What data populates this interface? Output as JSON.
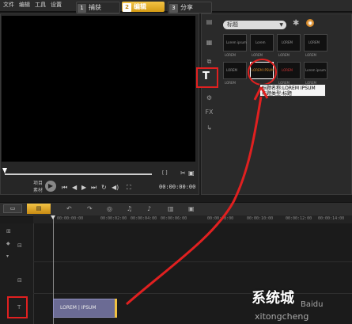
{
  "menu": {
    "file": "文件",
    "edit": "编辑",
    "tools": "工具",
    "settings": "设置"
  },
  "tabs": {
    "capture": {
      "num": "1",
      "label": "捕获"
    },
    "edit": {
      "num": "2",
      "label": "编辑"
    },
    "share": {
      "num": "3",
      "label": "分享"
    }
  },
  "player": {
    "project_label": "项目",
    "clip_label": "素材",
    "timecode": "00:00:00:00"
  },
  "library": {
    "gallery": "标题",
    "thumb_label": "LOREM",
    "thumb_row1": [
      "Lorem ipsum",
      "Lorem",
      "LOREM",
      "LOREM"
    ],
    "thumb_row2": [
      "LOREM",
      "LOREM IPSUM",
      "LOREM",
      "Lorem ipsum"
    ],
    "tooltip_line1": "标题名称:LOREM IPSUM",
    "tooltip_line2": "标题类型:标题"
  },
  "timeline": {
    "ticks": [
      "00:00:00:00",
      "00:00:02:00",
      "00:00:04:00",
      "00:00:06:00",
      "00:00:08:00",
      "00:00:10:00",
      "00:00:12:00",
      "00:00:14:00"
    ],
    "clip_label": "LOREM | IPSUM"
  },
  "watermark": {
    "brand": "系统城",
    "site": "xitongcheng",
    "baidu": "Baidu"
  },
  "colors": {
    "accent": "#f3c445",
    "highlight": "#e02020",
    "clip": "#6b6b94"
  }
}
